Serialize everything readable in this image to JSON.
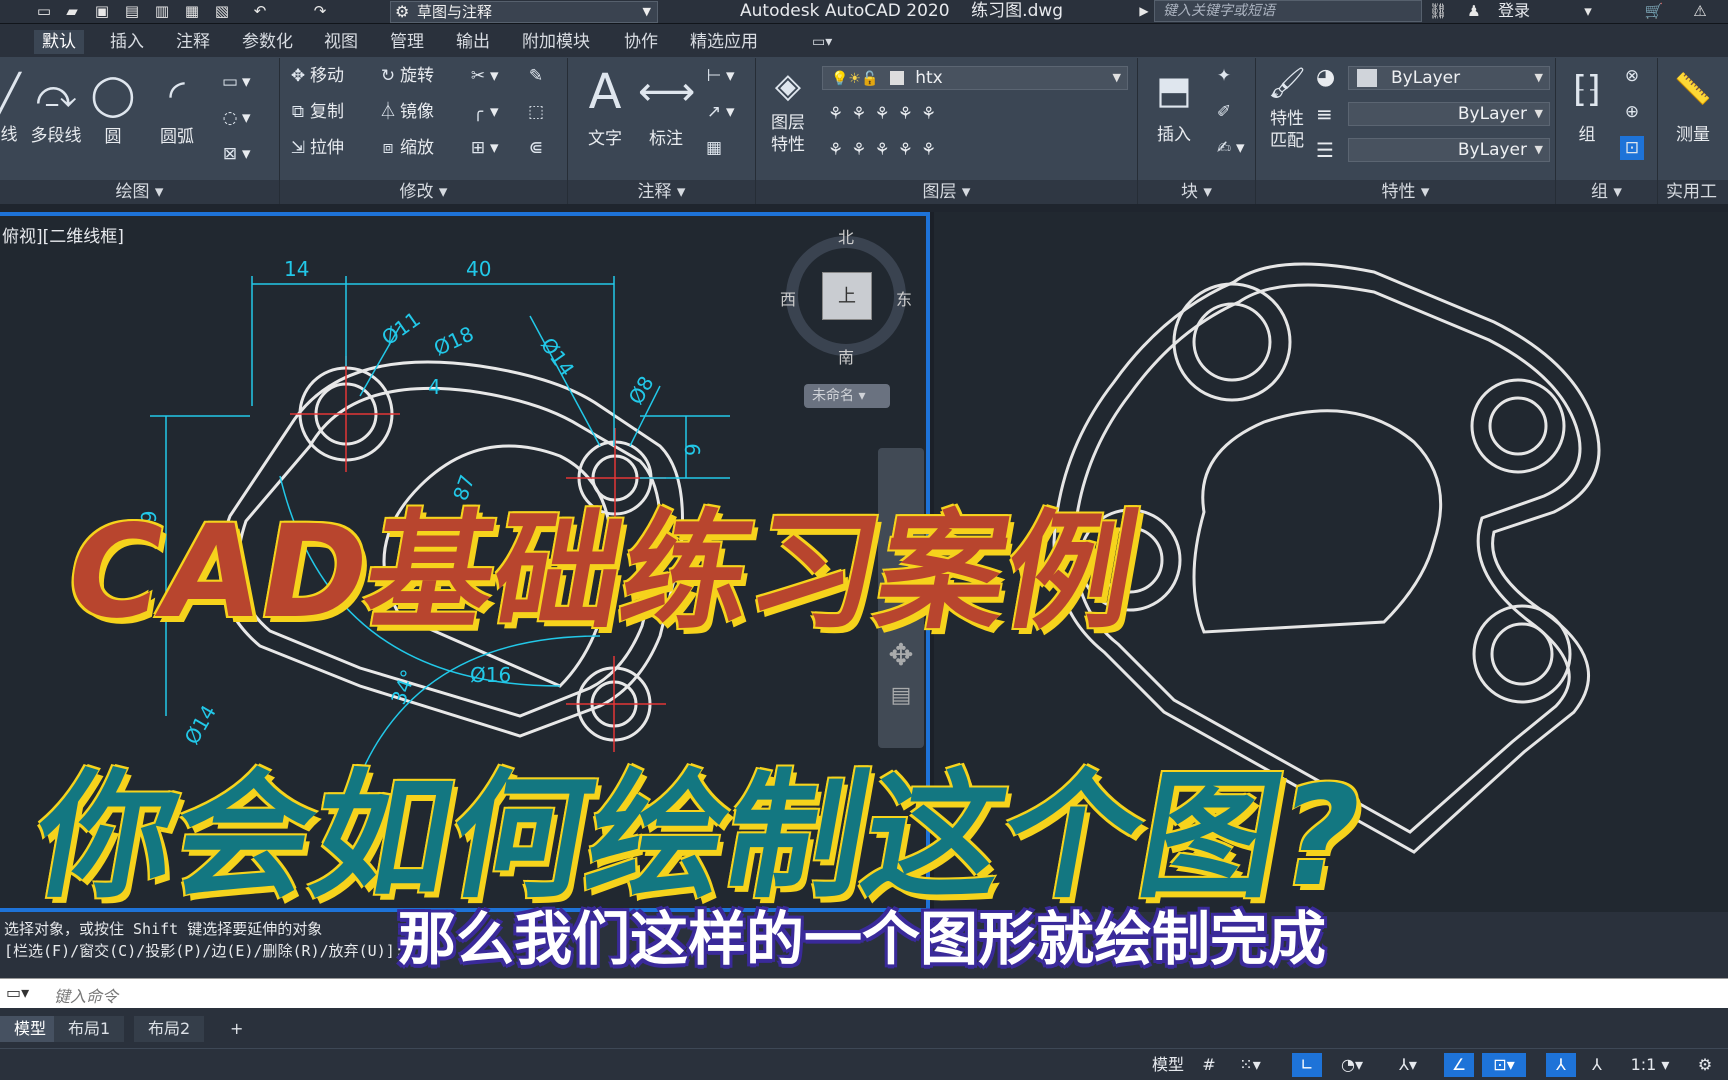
{
  "titlebar": {
    "workspace": "草图与注释",
    "app_title": "Autodesk AutoCAD 2020    练习图.dwg",
    "search_placeholder": "键入关键字或短语",
    "login": "登录"
  },
  "tabs": [
    "默认",
    "插入",
    "注释",
    "参数化",
    "视图",
    "管理",
    "输出",
    "附加模块",
    "协作",
    "精选应用"
  ],
  "ribbon": {
    "draw": {
      "title": "绘图",
      "items": [
        "线",
        "多段线",
        "圆",
        "圆弧"
      ]
    },
    "modify": {
      "title": "修改",
      "items": [
        "移动",
        "旋转",
        "复制",
        "镜像",
        "拉伸",
        "缩放"
      ]
    },
    "annotation": {
      "title": "注释",
      "items": [
        "文字",
        "标注"
      ]
    },
    "layers": {
      "title": "图层",
      "layer_props": "图层\n特性",
      "current_layer": "htx"
    },
    "block": {
      "title": "块",
      "insert": "插入"
    },
    "properties": {
      "title": "特性",
      "match": "特性\n匹配",
      "color": "ByLayer",
      "linetype": "ByLayer",
      "lineweight": "ByLayer"
    },
    "groups": {
      "title": "组",
      "group": "组"
    },
    "utilities": {
      "title": "实用工具",
      "measure": "测量"
    }
  },
  "viewport": {
    "label": "俯视][二维线框]",
    "viewcube": {
      "north": "北",
      "south": "南",
      "east": "东",
      "west": "西",
      "top": "上",
      "wcs": "未命名"
    }
  },
  "dimensions": [
    "14",
    "40",
    "Ø11",
    "Ø18",
    "Ø14",
    "Ø8",
    "9",
    "29",
    "Ø16",
    "Ø14",
    "34°",
    "4",
    "87"
  ],
  "command": {
    "history1": "选择对象，或按住 Shift 键选择要延伸的对象",
    "history2": "[栏选(F)/窗交(C)/投影(P)/边(E)/删除(R)/放弃(U)]:",
    "input_placeholder": "键入命令"
  },
  "layouts": [
    "模型",
    "布局1",
    "布局2"
  ],
  "status": {
    "model": "模型",
    "scale": "1:1"
  },
  "overlay": {
    "line1": "CAD基础练习案例",
    "line2": "你会如何绘制这个图?",
    "subtitle": "那么我们这样的一个图形就绘制完成"
  },
  "colors": {
    "accent": "#1e73d8",
    "overlay1": "#b8452e",
    "overlay2": "#137781",
    "outline": "#f6d31c",
    "dim": "#22c8e8"
  }
}
